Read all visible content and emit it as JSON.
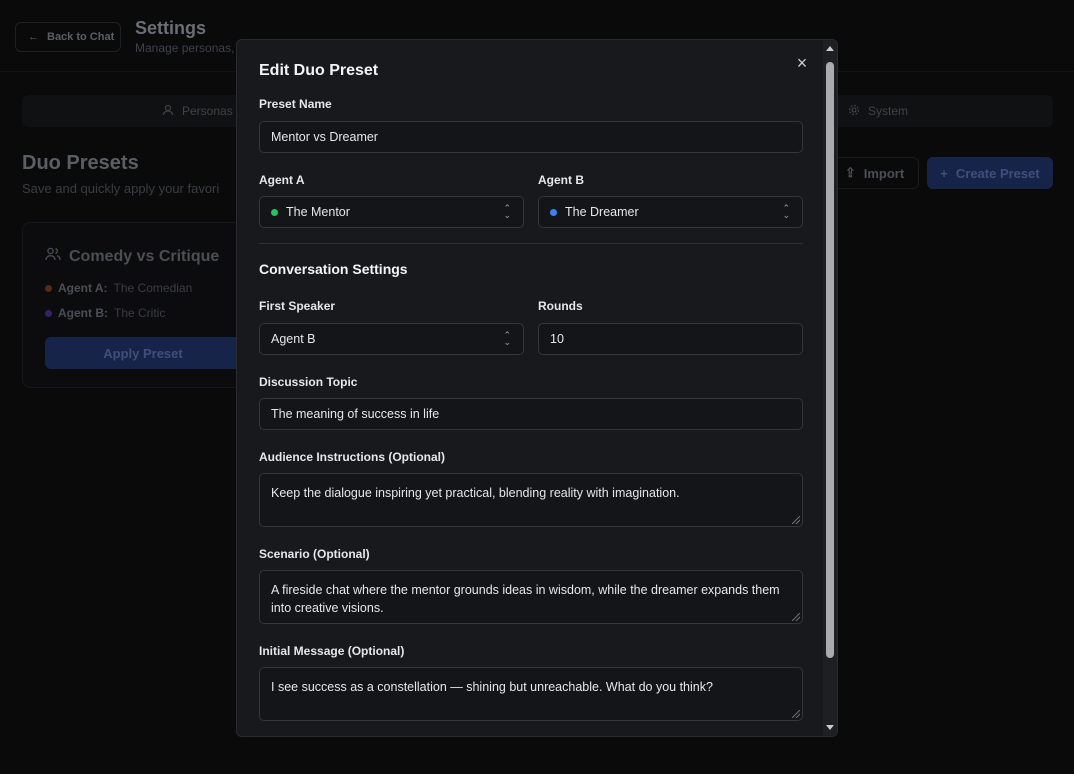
{
  "background": {
    "back_button": "Back to Chat",
    "title": "Settings",
    "subtitle": "Manage personas,",
    "tabs": [
      {
        "label": "Personas",
        "icon": "user-icon"
      },
      {
        "label": "System",
        "icon": "gear-icon"
      }
    ],
    "section_title": "Duo Presets",
    "section_subtitle": "Save and quickly apply your favori",
    "import_button": "Import",
    "create_button": "Create Preset",
    "card": {
      "title": "Comedy vs Critique",
      "agent_a_label": "Agent A:",
      "agent_a_value": "The Comedian",
      "agent_b_label": "Agent B:",
      "agent_b_value": "The Critic",
      "apply_button": "Apply Preset"
    }
  },
  "modal": {
    "title": "Edit Duo Preset",
    "preset_name_label": "Preset Name",
    "preset_name_value": "Mentor vs Dreamer",
    "agent_a_label": "Agent A",
    "agent_a_value": "The Mentor",
    "agent_b_label": "Agent B",
    "agent_b_value": "The Dreamer",
    "conversation_heading": "Conversation Settings",
    "first_speaker_label": "First Speaker",
    "first_speaker_value": "Agent B",
    "rounds_label": "Rounds",
    "rounds_value": "10",
    "topic_label": "Discussion Topic",
    "topic_value": "The meaning of success in life",
    "audience_label": "Audience Instructions (Optional)",
    "audience_value": "Keep the dialogue inspiring yet practical, blending reality with imagination.",
    "scenario_label": "Scenario (Optional)",
    "scenario_value": "A fireside chat where the mentor grounds ideas in wisdom, while the dreamer expands them into creative visions.",
    "initial_label": "Initial Message (Optional)",
    "initial_value": "I see success as a constellation — shining but unreachable. What do you think?"
  },
  "colors": {
    "agent_a_dot": "#22c55e",
    "agent_b_dot": "#3b82f6",
    "comedian_dot": "#c2410c",
    "critic_dot": "#6d28d9"
  }
}
